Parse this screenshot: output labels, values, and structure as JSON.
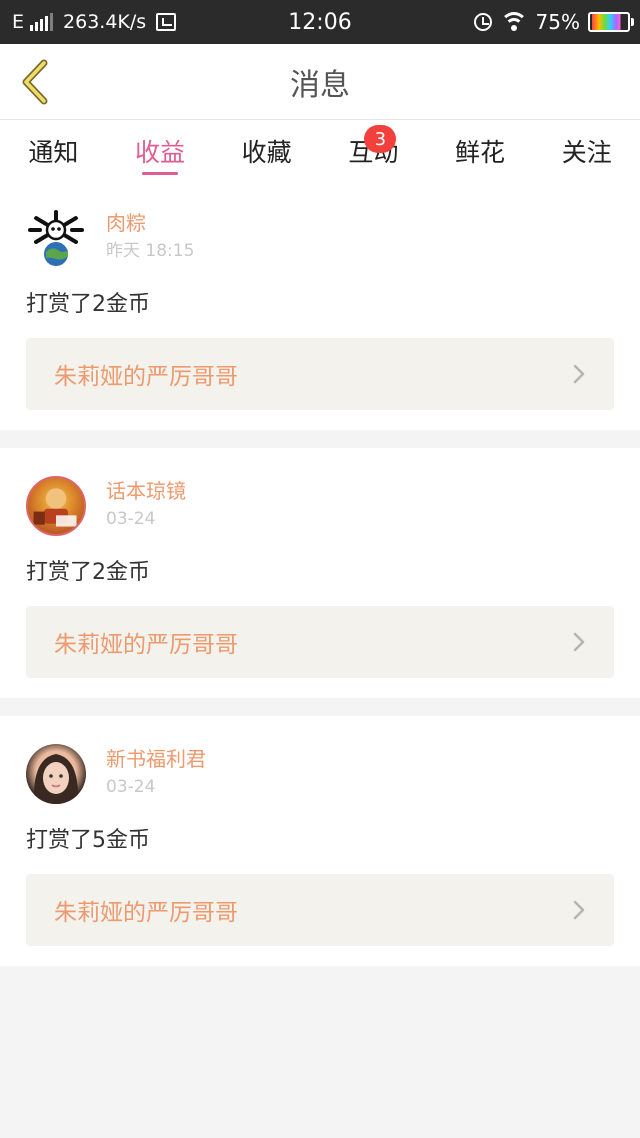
{
  "status_bar": {
    "network": "E",
    "speed": "263.4K/s",
    "time": "12:06",
    "battery": "75%"
  },
  "header": {
    "title": "消息"
  },
  "tabs": [
    {
      "label": "通知"
    },
    {
      "label": "收益",
      "active": true
    },
    {
      "label": "收藏"
    },
    {
      "label": "互动",
      "badge": "3"
    },
    {
      "label": "鲜花"
    },
    {
      "label": "关注"
    }
  ],
  "messages": [
    {
      "name": "肉粽",
      "time": "昨天 18:15",
      "text": "打赏了2金币",
      "book": "朱莉娅的严厉哥哥",
      "avatar": "avatar-skull-globe"
    },
    {
      "name": "话本琼镜",
      "time": "03-24",
      "text": "打赏了2金币",
      "book": "朱莉娅的严厉哥哥",
      "avatar": "avatar-cartoon"
    },
    {
      "name": "新书福利君",
      "time": "03-24",
      "text": "打赏了5金币",
      "book": "朱莉娅的严厉哥哥",
      "avatar": "avatar-girl"
    }
  ],
  "colors": {
    "accent": "#e05d94",
    "name": "#ec9a6e",
    "badge": "#f2413c"
  }
}
